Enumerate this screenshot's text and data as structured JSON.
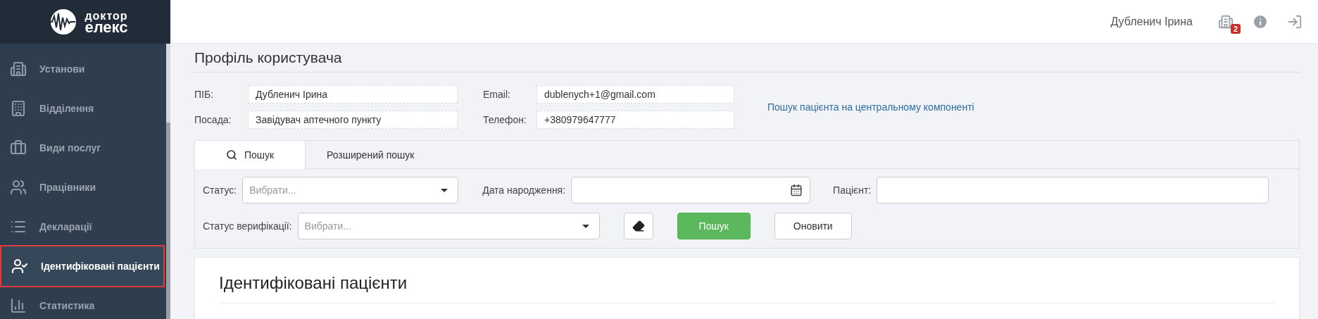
{
  "logo": {
    "line1": "доктор",
    "line2": "елекс"
  },
  "sidebar": {
    "items": [
      {
        "label": "Установи",
        "selected": false
      },
      {
        "label": "Відділення",
        "selected": false
      },
      {
        "label": "Види послуг",
        "selected": false
      },
      {
        "label": "Працівники",
        "selected": false
      },
      {
        "label": "Декларації",
        "selected": false
      },
      {
        "label": "Ідентифіковані пацієнти",
        "selected": true
      },
      {
        "label": "Статистика",
        "selected": false
      }
    ]
  },
  "header": {
    "user_name": "Дубленич Ірина",
    "badge": "2"
  },
  "profile": {
    "title": "Профіль користувача",
    "fields": [
      {
        "label": "ПІБ:",
        "value": "Дубленич Ірина"
      },
      {
        "label": "Email:",
        "value": "dublenych+1@gmail.com"
      },
      {
        "label": "Посада:",
        "value": "Завідувач аптечного пункту"
      },
      {
        "label": "Телефон:",
        "value": "+380979647777"
      }
    ],
    "link": "Пошук пацієнта на центральному компоненті"
  },
  "search": {
    "tabs": [
      {
        "label": "Пошук",
        "selected": true
      },
      {
        "label": "Розширений пошук",
        "selected": false
      }
    ],
    "status": {
      "label": "Статус:",
      "placeholder": "Вибрати..."
    },
    "birth_date": {
      "label": "Дата народження:"
    },
    "patient": {
      "label": "Пацієнт:"
    },
    "verification_status": {
      "label": "Статус верифікації:",
      "placeholder": "Вибрати..."
    },
    "buttons": [
      {
        "kind": "primary",
        "label": "Пошук"
      },
      {
        "kind": "default",
        "label": "Оновити"
      }
    ]
  },
  "results": {
    "title": "Ідентифіковані пацієнти"
  }
}
